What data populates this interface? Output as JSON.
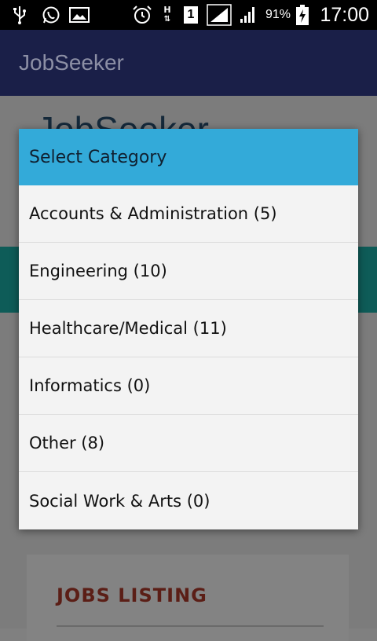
{
  "status_bar": {
    "time": "17:00",
    "battery_percent": "91%",
    "sim_slot": "1",
    "network_type": "H",
    "icons": [
      "usb-icon",
      "whatsapp-icon",
      "gallery-icon",
      "alarm-icon",
      "data-transfer-icon",
      "sim-icon",
      "signal-icon",
      "signal-icon",
      "battery-charging-icon"
    ]
  },
  "app_bar": {
    "title": "JobSeeker"
  },
  "background": {
    "heading": "JobSeeker",
    "card_title": "JOBS LISTING"
  },
  "dialog": {
    "title": "Select Category",
    "items": [
      {
        "label": "Accounts & Administration (5)"
      },
      {
        "label": "Engineering (10)"
      },
      {
        "label": "Healthcare/Medical (11)"
      },
      {
        "label": "Informatics (0)"
      },
      {
        "label": "Other (8)"
      },
      {
        "label": "Social Work & Arts (0)"
      }
    ]
  },
  "colors": {
    "dialog_title_bg": "#33aad9",
    "app_bar_bg": "#1a1f48",
    "teal_band": "#0e5c58",
    "card_title": "#5b1e16"
  }
}
